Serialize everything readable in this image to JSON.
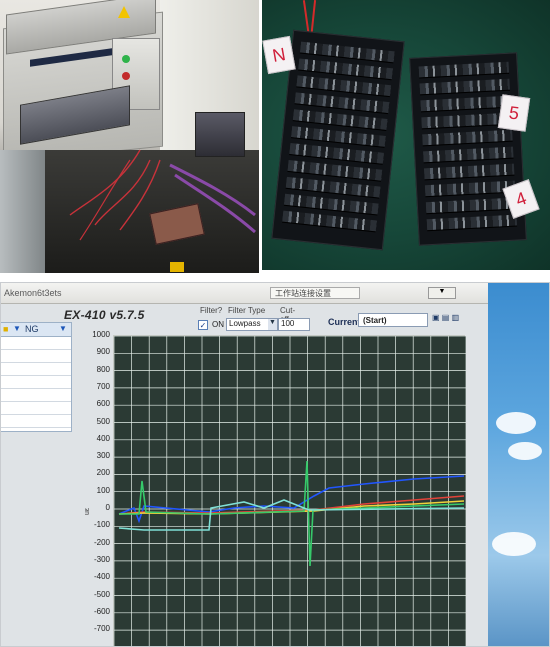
{
  "photos": {
    "machine": {
      "icon": "pcb-depaneling-machine"
    },
    "pcb_strips": {
      "labels": [
        "N",
        "5",
        "4"
      ]
    },
    "screen": {
      "topbar_title": "Akemon6t3ets",
      "topbar_tab": "工作站连接设置",
      "topbar_dropdown": "▼",
      "ng_label": "NG",
      "app_title": "EX-410 v5.7.5",
      "filter": {
        "label": "Filter?",
        "checkbox_mark": "✓",
        "on_text": "ON",
        "type_label": "Filter Type",
        "type_value": "Lowpass",
        "cutoff_label": "Cut-off",
        "cutoff_value": "100"
      },
      "current": {
        "label": "Current:",
        "value": "(Start)",
        "icons": "▣ ▤ ▥"
      },
      "y_unit": "uε",
      "y_ticks": [
        "1000",
        "900",
        "800",
        "700",
        "600",
        "500",
        "400",
        "300",
        "200",
        "100",
        "0",
        "-100",
        "-200",
        "-300",
        "-400",
        "-500",
        "-600",
        "-700"
      ]
    }
  },
  "colors": {
    "plot_bg": "#2b3a34",
    "grid": "#e6f0ea",
    "trace_blue": "#2156ff",
    "trace_red": "#e2433a",
    "trace_yellow": "#f0d23a",
    "trace_green": "#36c96a",
    "trace_cyan": "#7fe0d6"
  }
}
